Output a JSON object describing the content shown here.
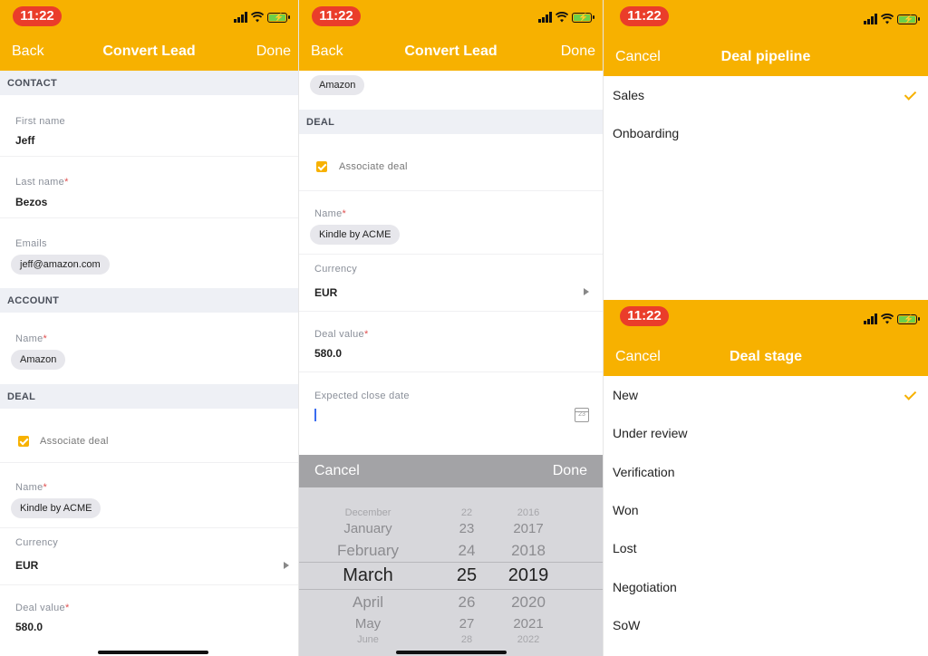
{
  "status_time": "11:22",
  "accent_color": "#f7b100",
  "panel1": {
    "nav": {
      "back": "Back",
      "title": "Convert Lead",
      "done": "Done"
    },
    "contact_header": "CONTACT",
    "first_name_label": "First name",
    "first_name_value": "Jeff",
    "last_name_label": "Last name",
    "last_name_value": "Bezos",
    "required_mark": "*",
    "emails_label": "Emails",
    "email_value": "jeff@amazon.com",
    "account_header": "ACCOUNT",
    "account_name_label": "Name",
    "account_name_value": "Amazon",
    "deal_header": "DEAL",
    "associate_deal_label": "Associate deal",
    "deal_name_label": "Name",
    "deal_name_value": "Kindle by ACME",
    "currency_label": "Currency",
    "currency_value": "EUR",
    "deal_value_label": "Deal value",
    "deal_value_value": "580.0"
  },
  "panel2": {
    "nav": {
      "back": "Back",
      "title": "Convert Lead",
      "done": "Done"
    },
    "account_chip": "Amazon",
    "deal_header": "DEAL",
    "associate_deal_label": "Associate deal",
    "deal_name_label": "Name",
    "deal_name_value": "Kindle by ACME",
    "currency_label": "Currency",
    "currency_value": "EUR",
    "deal_value_label": "Deal value",
    "deal_value_value": "580.0",
    "close_date_label": "Expected close date",
    "calendar_icon_text": "23",
    "picker": {
      "cancel": "Cancel",
      "done": "Done",
      "months": [
        "December",
        "January",
        "February",
        "March",
        "April",
        "May",
        "June"
      ],
      "days": [
        "22",
        "23",
        "24",
        "25",
        "26",
        "27",
        "28"
      ],
      "years": [
        "2016",
        "2017",
        "2018",
        "2019",
        "2020",
        "2021",
        "2022"
      ],
      "selected_index": 3
    }
  },
  "panel3": {
    "nav": {
      "cancel": "Cancel",
      "title": "Deal pipeline"
    },
    "options": [
      "Sales",
      "Onboarding"
    ],
    "selected": "Sales"
  },
  "panel4": {
    "nav": {
      "cancel": "Cancel",
      "title": "Deal stage"
    },
    "options": [
      "New",
      "Under review",
      "Verification",
      "Won",
      "Lost",
      "Negotiation",
      "SoW"
    ],
    "selected": "New"
  }
}
